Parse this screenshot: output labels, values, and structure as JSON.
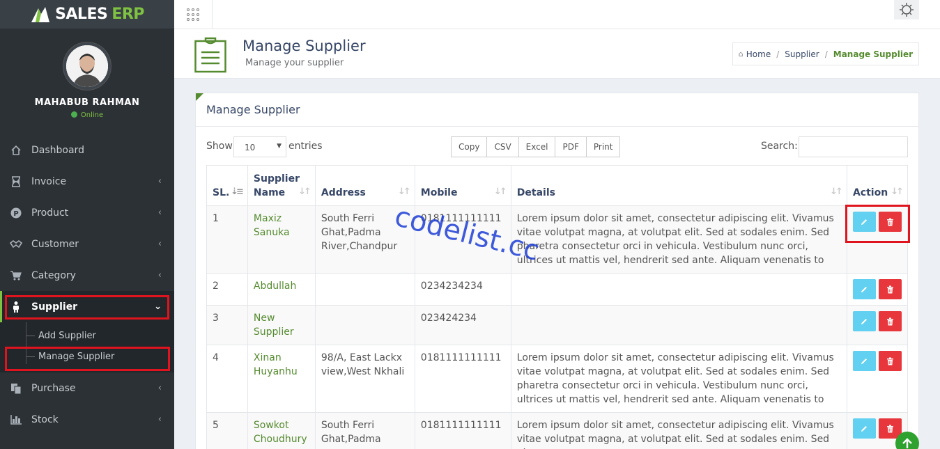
{
  "app": {
    "brand": "SALES",
    "brand_accent": "ERP",
    "accent_color": "#7fc242"
  },
  "user": {
    "name": "MAHABUB RAHMAN",
    "status": "Online"
  },
  "nav": [
    {
      "label": "Dashboard",
      "icon": "home-icon"
    },
    {
      "label": "Invoice",
      "icon": "hourglass-icon"
    },
    {
      "label": "Product",
      "icon": "product-icon"
    },
    {
      "label": "Customer",
      "icon": "handshake-icon"
    },
    {
      "label": "Category",
      "icon": "cart-icon"
    },
    {
      "label": "Supplier",
      "icon": "person-icon"
    },
    {
      "label": "Purchase",
      "icon": "copy-icon"
    },
    {
      "label": "Stock",
      "icon": "bar-chart-icon"
    }
  ],
  "submenu": [
    {
      "label": "Add Supplier"
    },
    {
      "label": "Manage Supplier"
    }
  ],
  "header": {
    "title": "Manage Supplier",
    "subtitle": "Manage your supplier"
  },
  "breadcrumb": {
    "home": "Home",
    "parent": "Supplier",
    "current": "Manage Supplier"
  },
  "panel": {
    "title": "Manage Supplier"
  },
  "controls": {
    "show_label": "Show",
    "page_length": "10",
    "entries_label": "entries",
    "buttons": [
      "Copy",
      "CSV",
      "Excel",
      "PDF",
      "Print"
    ],
    "search_label": "Search:"
  },
  "table": {
    "headers": [
      "SL.",
      "Supplier Name",
      "Address",
      "Mobile",
      "Details",
      "Action"
    ],
    "rows": [
      {
        "sl": "1",
        "name": "Maxiz Sanuka",
        "address": "South Ferri Ghat,Padma River,Chandpur",
        "mobile": "0181111111111",
        "details": "Lorem ipsum dolor sit amet, consectetur adipiscing elit. Vivamus vitae volutpat magna, at volutpat elit. Sed at sodales enim. Sed pharetra consectetur orci in vehicula. Vestibulum nunc orci, ultrices ut mattis vel, hendrerit sed ante. Aliquam venenatis to"
      },
      {
        "sl": "2",
        "name": "Abdullah",
        "address": "",
        "mobile": "0234234234",
        "details": ""
      },
      {
        "sl": "3",
        "name": "New Supplier",
        "address": "",
        "mobile": "023424234",
        "details": ""
      },
      {
        "sl": "4",
        "name": "Xinan Huyanhu",
        "address": "98/A, East Lackx view,West Nkhali",
        "mobile": "0181111111111",
        "details": "Lorem ipsum dolor sit amet, consectetur adipiscing elit. Vivamus vitae volutpat magna, at volutpat elit. Sed at sodales enim. Sed pharetra consectetur orci in vehicula. Vestibulum nunc orci, ultrices ut mattis vel, hendrerit sed ante. Aliquam venenatis to"
      },
      {
        "sl": "5",
        "name": "Sowkot Choudhury",
        "address": "South Ferri Ghat,Padma",
        "mobile": "0181111111111",
        "details": "Lorem ipsum dolor sit amet, consectetur adipiscing elit. Vivamus vitae volutpat magna, at volutpat elit. Sed at sodales enim. Sed pharetra"
      }
    ]
  },
  "watermark": "codelist.cc"
}
